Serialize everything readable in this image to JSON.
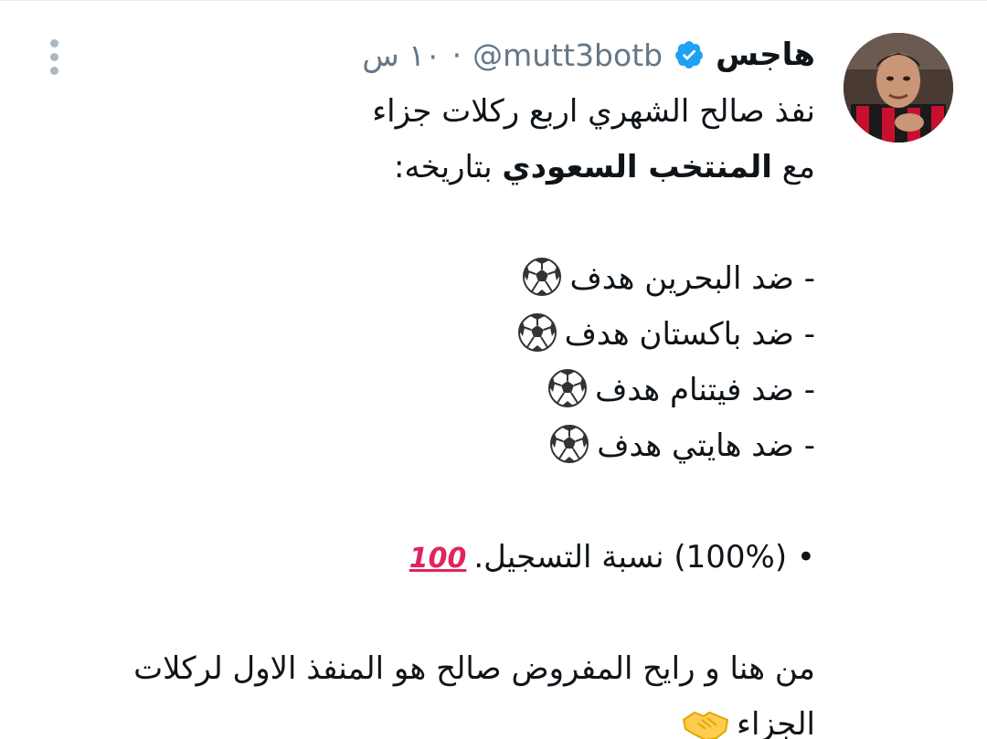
{
  "author": {
    "display_name": "هاجس",
    "handle": "@mutt3botb",
    "verified": true,
    "time": "١٠ س",
    "separator": "·"
  },
  "tweet": {
    "lines": [
      "نفذ صالح الشهري اربع ركلات جزاء",
      "بتاريخه:",
      "- ضد البحرين هدف",
      "- ضد باكستان هدف",
      "- ضد فيتنام هدف",
      "- ضد هايتي هدف",
      "• (100%) نسبة التسجيل.",
      "من هنا و رايح المفروض صالح هو المنفذ الاول لركلات",
      "الجزاء"
    ],
    "line2_prefix": "مع",
    "line2_bold": "المنتخب السعودي",
    "emoji_100": "100"
  },
  "icons": [
    "more-vertical-icon",
    "verified-badge-icon",
    "soccer-ball-icon",
    "hundred-points-icon",
    "handshake-icon"
  ],
  "colors": {
    "text": "#0f1419",
    "secondary": "#657786",
    "verified": "#1da1f2",
    "hundred": "#e0245e"
  }
}
